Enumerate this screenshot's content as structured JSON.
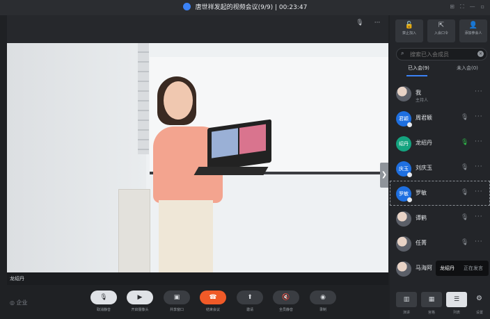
{
  "window": {
    "title": "唐世祥发起的视频会议(9/9)",
    "timer": "00:23:47",
    "controls": [
      "⊞",
      "⛶",
      "—",
      "▫"
    ]
  },
  "video": {
    "speaker_label": "龙绍丹",
    "top_icons": {
      "mic": "🎙",
      "more": "···"
    },
    "expand_arrow": "❯"
  },
  "panel": {
    "buttons": [
      {
        "icon": "🔓",
        "label": "禁止加入"
      },
      {
        "icon": "⇱",
        "label": "入会口令"
      },
      {
        "icon": "👤",
        "label": "添加参会人"
      }
    ],
    "search_placeholder": "搜索已入会成员",
    "clear_icon": "×",
    "search_icon": "⌕",
    "tabs": [
      {
        "label": "已入会(9)",
        "active": true
      },
      {
        "label": "未入会(0)",
        "active": false
      }
    ],
    "members": [
      {
        "avatar_text": "",
        "avatar_type": "photo",
        "name": "我",
        "sub": "主持人",
        "mic": "",
        "mic_on": false
      },
      {
        "avatar_text": "君颖",
        "avatar_type": "blue",
        "name": "周君颖",
        "sub": "",
        "mic": "🎙",
        "mic_on": false
      },
      {
        "avatar_text": "绍丹",
        "avatar_type": "green",
        "name": "龙绍丹",
        "sub": "",
        "mic": "🎙",
        "mic_on": true
      },
      {
        "avatar_text": "庆玉",
        "avatar_type": "blue",
        "name": "刘庆玉",
        "sub": "",
        "mic": "🎙",
        "mic_on": false
      },
      {
        "avatar_text": "罗敏",
        "avatar_type": "blue",
        "name": "罗敏",
        "sub": "",
        "mic": "🎙",
        "mic_on": false,
        "selected": true
      },
      {
        "avatar_text": "",
        "avatar_type": "photo",
        "name": "谭鹤",
        "sub": "",
        "mic": "🎙",
        "mic_on": false
      },
      {
        "avatar_text": "",
        "avatar_type": "photo",
        "name": "任菁",
        "sub": "",
        "mic": "🎙",
        "mic_on": false
      },
      {
        "avatar_text": "",
        "avatar_type": "photo",
        "name": "马海阿",
        "sub": "",
        "mic": "",
        "mic_on": false
      }
    ],
    "more_label": "···"
  },
  "toast": {
    "name": "龙绍丹",
    "status": "正在发言"
  },
  "bottom": {
    "logo": "◎ 企业",
    "controls": [
      {
        "icon": "🎙",
        "label": "取消静音",
        "style": "light"
      },
      {
        "icon": "▶",
        "label": "开启摄像头",
        "style": "light"
      },
      {
        "icon": "▣",
        "label": "共享窗口",
        "style": "dark"
      },
      {
        "icon": "☎",
        "label": "结束会议",
        "style": "red"
      },
      {
        "icon": "⬆",
        "label": "邀请",
        "style": "dark"
      },
      {
        "icon": "🔇",
        "label": "全员静音",
        "style": "dark"
      },
      {
        "icon": "◉",
        "label": "录制",
        "style": "dark"
      }
    ],
    "right_controls": [
      {
        "icon": "▥",
        "label": "演讲"
      },
      {
        "icon": "▦",
        "label": "宫格"
      },
      {
        "icon": "☰",
        "label": "列表",
        "active": true
      }
    ],
    "settings_label": "设置",
    "settings_icon": "⚙"
  }
}
